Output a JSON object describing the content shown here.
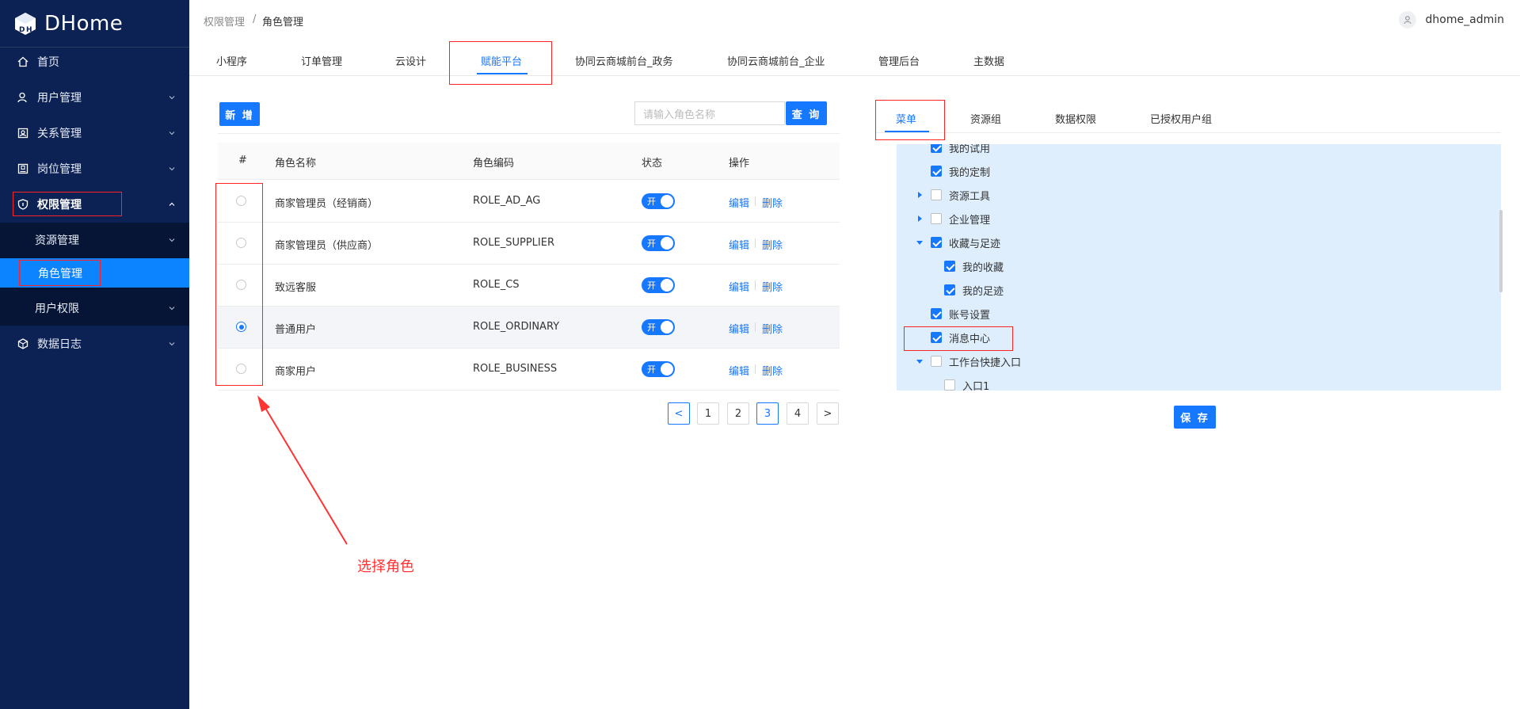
{
  "app": {
    "logo_text": "DHome"
  },
  "sidebar": {
    "items": [
      {
        "label": "首页",
        "icon": "home-icon"
      },
      {
        "label": "用户管理",
        "icon": "user-icon"
      },
      {
        "label": "关系管理",
        "icon": "relation-icon"
      },
      {
        "label": "岗位管理",
        "icon": "post-icon"
      },
      {
        "label": "权限管理",
        "icon": "shield-icon",
        "expanded": true
      },
      {
        "label": "数据日志",
        "icon": "data-log-icon"
      }
    ],
    "sub_items": [
      {
        "label": "资源管理"
      },
      {
        "label": "角色管理",
        "active": true
      },
      {
        "label": "用户权限"
      }
    ]
  },
  "header": {
    "breadcrumb": [
      "权限管理",
      "角色管理"
    ],
    "breadcrumb_sep": "/",
    "username": "dhome_admin"
  },
  "top_tabs": [
    "小程序",
    "订单管理",
    "云设计",
    "赋能平台",
    "协同云商城前台_政务",
    "协同云商城前台_企业",
    "管理后台",
    "主数据"
  ],
  "top_tabs_active": "赋能平台",
  "left_panel": {
    "add_button": "新 增",
    "search_placeholder": "请输入角色名称",
    "search_button": "查 询",
    "columns": [
      "#",
      "角色名称",
      "角色编码",
      "状态",
      "操作"
    ],
    "rows": [
      {
        "name": "商家管理员（经销商）",
        "code": "ROLE_AD_AG",
        "status": "开",
        "selected": false
      },
      {
        "name": "商家管理员（供应商）",
        "code": "ROLE_SUPPLIER",
        "status": "开",
        "selected": false
      },
      {
        "name": "致远客服",
        "code": "ROLE_CS",
        "status": "开",
        "selected": false
      },
      {
        "name": "普通用户",
        "code": "ROLE_ORDINARY",
        "status": "开",
        "selected": true
      },
      {
        "name": "商家用户",
        "code": "ROLE_BUSINESS",
        "status": "开",
        "selected": false
      }
    ],
    "edit_label": "编辑",
    "delete_label": "删除",
    "pagination": {
      "prev": "<",
      "pages": [
        "1",
        "2",
        "3",
        "4"
      ],
      "current": "3",
      "next": ">"
    }
  },
  "right_panel": {
    "tabs": [
      "菜单",
      "资源组",
      "数据权限",
      "已授权用户组"
    ],
    "active_tab": "菜单",
    "tree": [
      {
        "label": "我的试用",
        "checked": true,
        "level": 1,
        "caret": ""
      },
      {
        "label": "我的定制",
        "checked": true,
        "level": 1,
        "caret": ""
      },
      {
        "label": "资源工具",
        "checked": false,
        "level": 1,
        "caret": "right"
      },
      {
        "label": "企业管理",
        "checked": false,
        "level": 1,
        "caret": "right"
      },
      {
        "label": "收藏与足迹",
        "checked": true,
        "level": 1,
        "caret": "down"
      },
      {
        "label": "我的收藏",
        "checked": true,
        "level": 2,
        "caret": ""
      },
      {
        "label": "我的足迹",
        "checked": true,
        "level": 2,
        "caret": ""
      },
      {
        "label": "账号设置",
        "checked": true,
        "level": 1,
        "caret": ""
      },
      {
        "label": "消息中心",
        "checked": true,
        "level": 1,
        "caret": ""
      },
      {
        "label": "工作台快捷入口",
        "checked": false,
        "level": 1,
        "caret": "down"
      },
      {
        "label": "入口1",
        "checked": false,
        "level": 2,
        "caret": ""
      }
    ],
    "save_button": "保 存"
  },
  "annotation": {
    "text": "选择角色",
    "color": "#ff3333"
  },
  "colors": {
    "sidebar_bg": "#0c2154",
    "accent": "#1677ff",
    "tree_bg": "#dfeefd"
  }
}
